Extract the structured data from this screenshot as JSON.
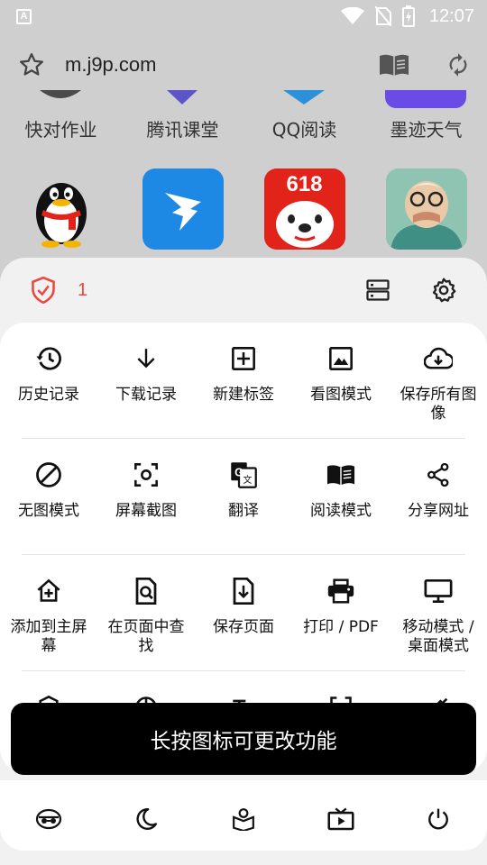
{
  "status_bar": {
    "time": "12:07",
    "app_badge": "A",
    "icons": [
      "wifi-icon",
      "no-sim-icon",
      "battery-charging-icon"
    ]
  },
  "url_bar": {
    "url": "m.j9p.com",
    "icons": [
      "star-icon",
      "reader-book-icon",
      "refresh-icon"
    ]
  },
  "shortcuts": {
    "row1": [
      {
        "label": "快对作业"
      },
      {
        "label": "腾讯课堂"
      },
      {
        "label": "QQ阅读"
      },
      {
        "label": "墨迹天气"
      }
    ],
    "row2": [
      {
        "name": "qq",
        "badge": ""
      },
      {
        "name": "dingtalk",
        "badge": ""
      },
      {
        "name": "jd-618",
        "badge": "618"
      },
      {
        "name": "avatar",
        "badge": ""
      }
    ]
  },
  "menu": {
    "blocked_count": "1",
    "header_icons": [
      "shield-icon",
      "server-icon",
      "settings-icon"
    ],
    "rows": [
      [
        {
          "label": "历史记录",
          "icon": "history-icon"
        },
        {
          "label": "下载记录",
          "icon": "download-icon"
        },
        {
          "label": "新建标签",
          "icon": "new-tab-icon"
        },
        {
          "label": "看图模式",
          "icon": "image-mode-icon"
        },
        {
          "label": "保存所有图像",
          "icon": "cloud-download-icon"
        }
      ],
      [
        {
          "label": "无图模式",
          "icon": "no-image-icon"
        },
        {
          "label": "屏幕截图",
          "icon": "screenshot-icon"
        },
        {
          "label": "翻译",
          "icon": "translate-icon"
        },
        {
          "label": "阅读模式",
          "icon": "reader-mode-icon"
        },
        {
          "label": "分享网址",
          "icon": "share-icon"
        }
      ],
      [
        {
          "label": "添加到主屏幕",
          "icon": "add-home-icon"
        },
        {
          "label": "在页面中查找",
          "icon": "find-in-page-icon"
        },
        {
          "label": "保存页面",
          "icon": "save-page-icon"
        },
        {
          "label": "打印 / PDF",
          "icon": "print-icon"
        },
        {
          "label": "移动模式 / 桌面模式",
          "icon": "desktop-icon"
        }
      ]
    ],
    "toast": "长按图标可更改功能",
    "bottom_icons": [
      "incognito-icon",
      "night-mode-icon",
      "bookmark-icon",
      "tv-icon",
      "power-icon"
    ]
  },
  "colors": {
    "accent_red": "#e8483e",
    "sheet_bg": "#f1f1f1",
    "page_bg": "#cfcfcf"
  }
}
